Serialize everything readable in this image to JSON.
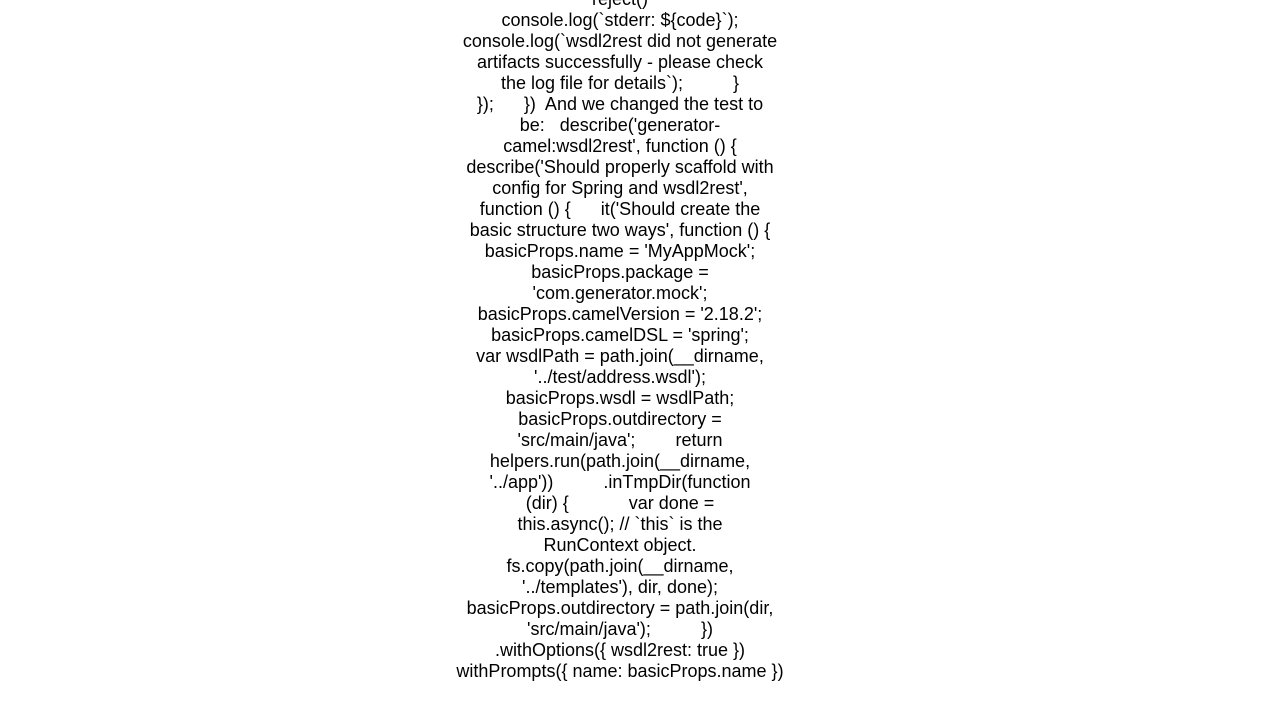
{
  "document": {
    "lines": [
      "reject()",
      "console.log(`stderr: ${code}`);",
      "console.log(`wsdl2rest did not generate",
      "artifacts successfully - please check",
      "the log file for details`);          }",
      "});      })  And we changed the test to",
      "be:   describe('generator-",
      "camel:wsdl2rest', function () {",
      "describe('Should properly scaffold with",
      "config for Spring and wsdl2rest',",
      "function () {      it('Should create the",
      "basic structure two ways', function () {",
      "basicProps.name = 'MyAppMock';",
      "basicProps.package =",
      "'com.generator.mock';",
      "basicProps.camelVersion = '2.18.2';",
      "basicProps.camelDSL = 'spring';",
      "var wsdlPath = path.join(__dirname,",
      "'../test/address.wsdl');",
      "basicProps.wsdl = wsdlPath;",
      "basicProps.outdirectory =",
      "'src/main/java';        return",
      "helpers.run(path.join(__dirname,",
      "'../app'))          .inTmpDir(function",
      "(dir) {            var done =",
      "this.async(); // `this` is the",
      "RunContext object.",
      "fs.copy(path.join(__dirname,",
      "'../templates'), dir, done);",
      "basicProps.outdirectory = path.join(dir,",
      "'src/main/java');          })",
      ".withOptions({ wsdl2rest: true })",
      "withPrompts({ name: basicProps.name })"
    ]
  }
}
